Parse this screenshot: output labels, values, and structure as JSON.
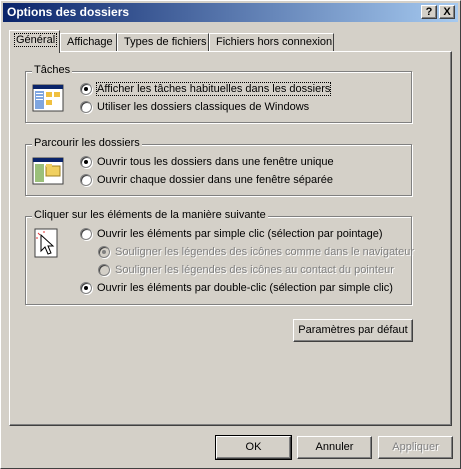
{
  "window": {
    "title": "Options des dossiers",
    "help_button": "?",
    "close_button": "X"
  },
  "tabs": [
    {
      "label": "Général",
      "active": true
    },
    {
      "label": "Affichage"
    },
    {
      "label": "Types de fichiers"
    },
    {
      "label": "Fichiers hors connexion"
    }
  ],
  "groups": {
    "tasks": {
      "title": "Tâches",
      "icon": "tasks-view-icon",
      "options": [
        {
          "label": "Afficher les tâches habituelles dans les dossiers",
          "checked": true,
          "focused": true
        },
        {
          "label": "Utiliser les dossiers classiques de Windows",
          "checked": false
        }
      ]
    },
    "browse": {
      "title": "Parcourir les dossiers",
      "icon": "folder-window-icon",
      "options": [
        {
          "label": "Ouvrir tous les dossiers dans une fenêtre unique",
          "checked": true
        },
        {
          "label": "Ouvrir chaque dossier dans une fenêtre séparée",
          "checked": false
        }
      ]
    },
    "click": {
      "title": "Cliquer sur les éléments de la manière suivante",
      "icon": "pointer-click-icon",
      "options": [
        {
          "label": "Ouvrir les éléments par simple clic (sélection par pointage)",
          "checked": false
        },
        {
          "label": "Souligner les légendes des icônes comme dans le navigateur",
          "checked": true,
          "disabled": true
        },
        {
          "label": "Souligner les légendes des icônes au contact du pointeur",
          "checked": false,
          "disabled": true
        },
        {
          "label": "Ouvrir les éléments par double-clic (sélection par simple clic)",
          "checked": true
        }
      ]
    }
  },
  "buttons": {
    "defaults": "Paramètres par défaut",
    "ok": "OK",
    "cancel": "Annuler",
    "apply": "Appliquer"
  },
  "colors": {
    "titlebar_start": "#0a246a",
    "titlebar_end": "#a6caf0",
    "face": "#d4d0c8"
  }
}
